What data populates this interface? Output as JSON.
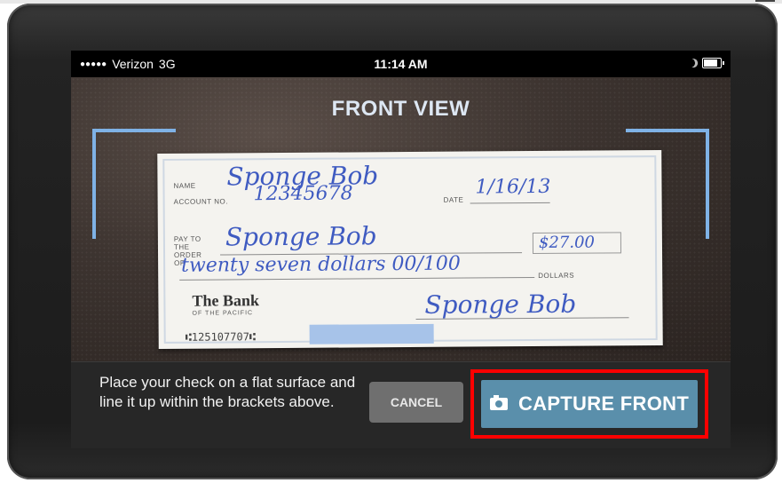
{
  "status_bar": {
    "signal": "●●●●●",
    "carrier": "Verizon",
    "network": "3G",
    "time": "11:14 AM"
  },
  "camera": {
    "title": "FRONT VIEW",
    "check": {
      "name": "Sponge Bob",
      "account_no": "12345678",
      "date": "1/16/13",
      "pay_to": "Sponge Bob",
      "amount": "$27.00",
      "amount_words": "twenty seven dollars 00/100",
      "signature": "Sponge Bob",
      "bank_name": "The Bank",
      "bank_sub": "OF THE PACIFIC",
      "micr": "⑆125107707⑆",
      "label_name": "NAME",
      "label_account": "ACCOUNT NO.",
      "label_date": "DATE",
      "label_pay": "PAY TO THE ORDER OF",
      "label_dollars": "DOLLARS"
    }
  },
  "footer": {
    "instructions": "Place your check on a flat surface and line it up within the brackets above.",
    "cancel_label": "CANCEL",
    "capture_label": "CAPTURE FRONT"
  },
  "colors": {
    "bracket": "#7fb2e6",
    "capture_button": "#5a8fab",
    "highlight": "#ff0000"
  }
}
